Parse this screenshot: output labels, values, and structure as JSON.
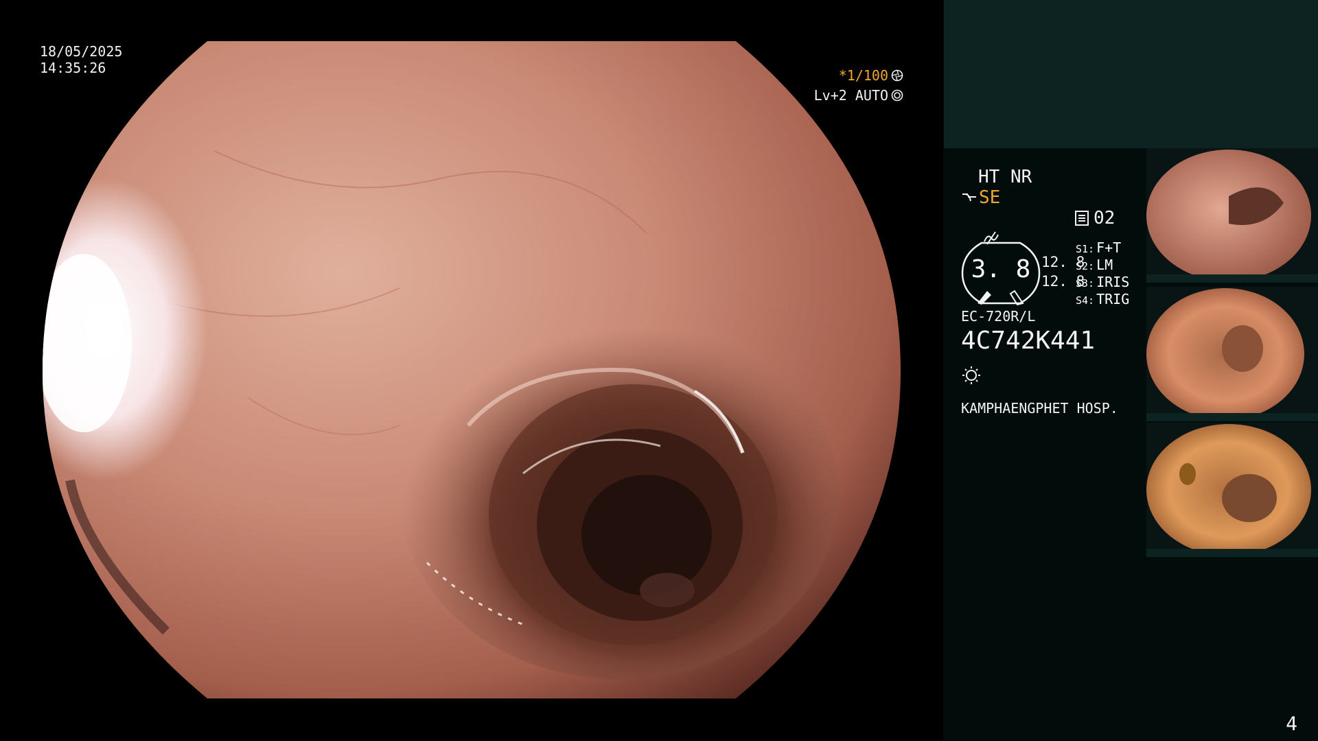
{
  "osd": {
    "date": "18/05/2025",
    "time": "14:35:26",
    "shutter": "*1/100",
    "iris_mode": "Lv+2 AUTO"
  },
  "panel": {
    "enhancement": "HT NR",
    "structure_mode": "SE",
    "card_number": "02",
    "gauge_value": "3. 8",
    "side_value_1": "12. 8",
    "side_value_2": "12. 8",
    "switches": [
      {
        "key": "S1:",
        "value": "F+T"
      },
      {
        "key": "S2:",
        "value": "LM"
      },
      {
        "key": "S3:",
        "value": "IRIS"
      },
      {
        "key": "S4:",
        "value": "TRIG"
      }
    ],
    "scope_model": "EC-720R/L",
    "scope_serial": "4C742K441",
    "hospital": "KAMPHAENGPHET HOSP."
  },
  "thumbnails": [
    {
      "label": "captured image 1"
    },
    {
      "label": "captured image 2"
    },
    {
      "label": "captured image 3"
    }
  ],
  "page_number": "4",
  "colors": {
    "accent_orange": "#f0a830",
    "panel_bg": "#020c0b",
    "panel_header_bg": "#0c2322",
    "mucosa": "#c98a76"
  },
  "icons": {
    "shutter": "aperture-icon",
    "iris": "iris-icon",
    "structure": "structure-enhance-icon",
    "color": "color-wave-icon",
    "card": "memory-card-icon",
    "light": "light-source-icon"
  }
}
